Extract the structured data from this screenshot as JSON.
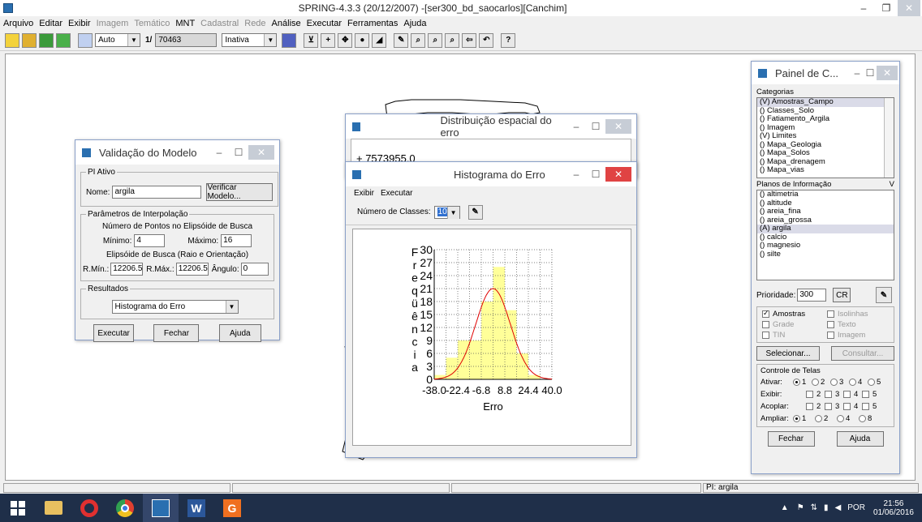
{
  "app": {
    "title": "SPRING-4.3.3 (20/12/2007) -[ser300_bd_saocarlos][Canchim]",
    "minimize": "–",
    "maximize": "❐",
    "close": "✕"
  },
  "menu": [
    {
      "label": "Arquivo",
      "enabled": true
    },
    {
      "label": "Editar",
      "enabled": true
    },
    {
      "label": "Exibir",
      "enabled": true
    },
    {
      "label": "Imagem",
      "enabled": false
    },
    {
      "label": "Temático",
      "enabled": false
    },
    {
      "label": "MNT",
      "enabled": true
    },
    {
      "label": "Cadastral",
      "enabled": false
    },
    {
      "label": "Rede",
      "enabled": false
    },
    {
      "label": "Análise",
      "enabled": true
    },
    {
      "label": "Executar",
      "enabled": true
    },
    {
      "label": "Ferramentas",
      "enabled": true
    },
    {
      "label": "Ajuda",
      "enabled": true
    }
  ],
  "toolbar": {
    "zoom_mode": "Auto",
    "scale_prefix": "1/",
    "scale_value": "70463",
    "mode": "Inativa",
    "help_glyph": "?"
  },
  "validacao": {
    "title": "Validação do Modelo",
    "pi_group": "PI Ativo",
    "nome_label": "Nome:",
    "nome_value": "argila",
    "verificar_button": "Verificar Modelo...",
    "interp_group": "Parâmetros de Interpolação",
    "num_pontos_label": "Número de Pontos no Elipsóide de Busca",
    "minimo_label": "Mínimo:",
    "minimo_value": "4",
    "maximo_label": "Máximo:",
    "maximo_value": "16",
    "elipsoide_label": "Elipsóide de Busca (Raio e Orientação)",
    "rmin_label": "R.Mín.:",
    "rmin_value": "12206.5",
    "rmax_label": "R.Máx.:",
    "rmax_value": "12206.5",
    "angulo_label": "Ângulo:",
    "angulo_value": "0",
    "resultados_group": "Resultados",
    "resultados_value": "Histograma do Erro",
    "executar_button": "Executar",
    "fechar_button": "Fechar",
    "ajuda_button": "Ajuda"
  },
  "distribuicao": {
    "title": "Distribuição espacial do erro",
    "coord_text": "+ 7573955.0"
  },
  "histograma": {
    "title": "Histograma do Erro",
    "menu_exibir": "Exibir",
    "menu_executar": "Executar",
    "num_classes_label": "Número de Classes:",
    "num_classes_value": "10"
  },
  "chart_data": {
    "type": "bar",
    "xlabel": "Erro",
    "ylabel": "Freqüência",
    "ylabel_letters": [
      "F",
      "r",
      "e",
      "q",
      "ü",
      "ê",
      "n",
      "c",
      "i",
      "a"
    ],
    "xlim": [
      -38.0,
      40.0
    ],
    "ylim": [
      0,
      30
    ],
    "x_ticks": [
      "-38.0",
      "-22.4",
      "-6.8",
      "8.8",
      "24.4",
      "40.0"
    ],
    "y_ticks": [
      "0",
      "3",
      "6",
      "9",
      "12",
      "15",
      "18",
      "21",
      "24",
      "27",
      "30"
    ],
    "bins": [
      {
        "x0": -38.0,
        "x1": -30.2,
        "value": 1
      },
      {
        "x0": -30.2,
        "x1": -22.4,
        "value": 5
      },
      {
        "x0": -22.4,
        "x1": -14.6,
        "value": 9
      },
      {
        "x0": -14.6,
        "x1": -6.8,
        "value": 9
      },
      {
        "x0": -6.8,
        "x1": 1.0,
        "value": 18
      },
      {
        "x0": 1.0,
        "x1": 8.8,
        "value": 26
      },
      {
        "x0": 8.8,
        "x1": 16.6,
        "value": 16
      },
      {
        "x0": 16.6,
        "x1": 24.4,
        "value": 6
      },
      {
        "x0": 24.4,
        "x1": 32.2,
        "value": 1
      },
      {
        "x0": 32.2,
        "x1": 40.0,
        "value": 0
      }
    ],
    "curve": {
      "type": "normal",
      "peak": 21,
      "mean": 1.0,
      "sd": 11.5
    },
    "bar_color": "#ffff99",
    "curve_color": "#e00000",
    "grid": true
  },
  "painel": {
    "title": "Painel de C...",
    "categorias_label": "Categorias",
    "categorias": [
      "(V) Amostras_Campo",
      "() Classes_Solo",
      "() Fatiamento_Argila",
      "() Imagem",
      "(V) Limites",
      "() Mapa_Geologia",
      "() Mapa_Solos",
      "() Mapa_drenagem",
      "() Mapa_vias"
    ],
    "planos_label": "Planos de Informação",
    "planos_v": "V",
    "planos": [
      "() altimetria",
      "() altitude",
      "() areia_fina",
      "() areia_grossa",
      "(A) argila",
      "() calcio",
      "() magnesio",
      "() silte"
    ],
    "prioridade_label": "Prioridade:",
    "prioridade_value": "300",
    "cr_button": "CR",
    "amostras": "Amostras",
    "isolinhas": "Isolinhas",
    "grade": "Grade",
    "texto": "Texto",
    "tin": "TIN",
    "imagem": "Imagem",
    "selecionar_button": "Selecionar...",
    "consultar_button": "Consultar...",
    "controle_label": "Controle de Telas",
    "ativar_label": "Ativar:",
    "exibir_label": "Exibir:",
    "acoplar_label": "Acoplar:",
    "ampliar_label": "Ampliar:",
    "n1": "1",
    "n2": "2",
    "n3": "3",
    "n4": "4",
    "n5": "5",
    "n8": "8",
    "fechar_button": "Fechar",
    "ajuda_button": "Ajuda"
  },
  "status": {
    "pi": "PI: argila"
  },
  "taskbar": {
    "lang": "POR",
    "time": "21:56",
    "date": "01/06/2016"
  }
}
